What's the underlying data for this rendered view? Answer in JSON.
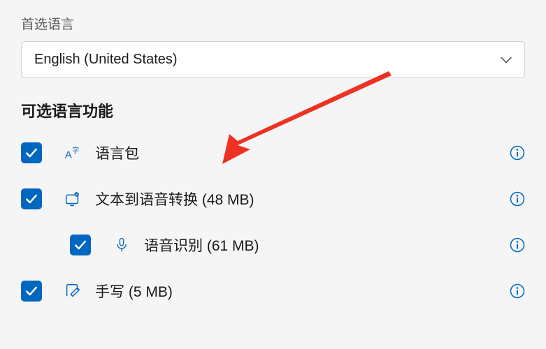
{
  "preferredLanguage": {
    "label": "首选语言",
    "selected": "English (United States)"
  },
  "optionalFeatures": {
    "header": "可选语言功能",
    "items": [
      {
        "label": "语言包",
        "checked": true,
        "indent": 0
      },
      {
        "label": "文本到语音转换 (48 MB)",
        "checked": true,
        "indent": 0
      },
      {
        "label": "语音识别 (61 MB)",
        "checked": true,
        "indent": 1
      },
      {
        "label": "手写 (5 MB)",
        "checked": true,
        "indent": 0
      }
    ]
  },
  "colors": {
    "accent": "#0067c0",
    "info": "#0067c0",
    "arrow": "#ed3223"
  }
}
